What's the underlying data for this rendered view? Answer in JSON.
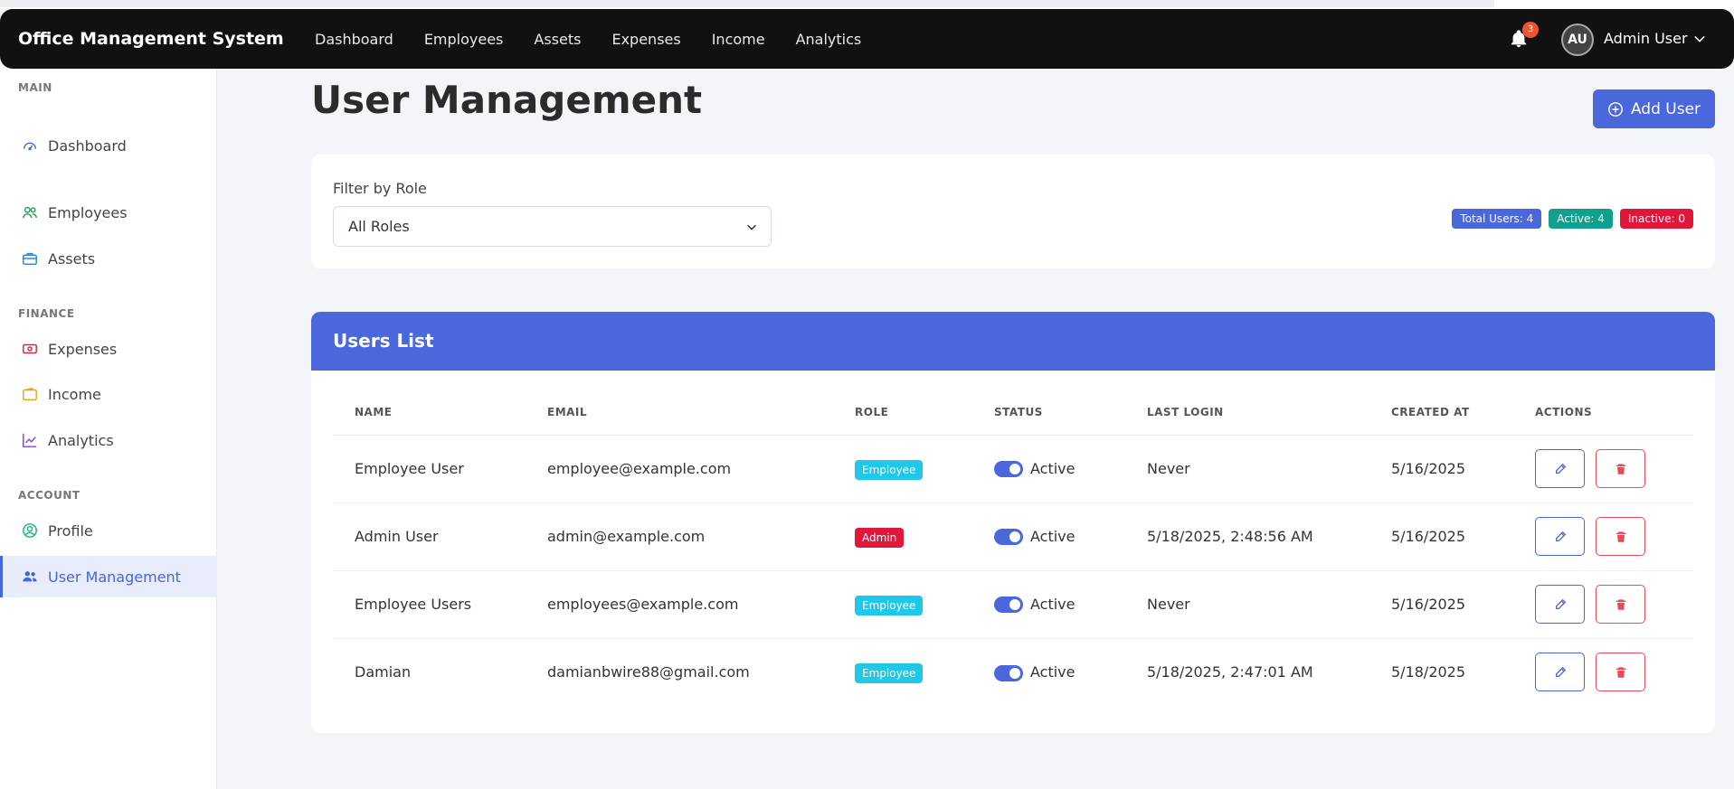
{
  "app": {
    "title": "Office Management System"
  },
  "topnav": [
    "Dashboard",
    "Employees",
    "Assets",
    "Expenses",
    "Income",
    "Analytics"
  ],
  "notifications": {
    "count": "3"
  },
  "user": {
    "initials": "AU",
    "name": "Admin User"
  },
  "sidebar": {
    "sections": {
      "main": "MAIN",
      "finance": "FINANCE",
      "account": "ACCOUNT"
    },
    "items": [
      {
        "label": "Dashboard",
        "icon": "dashboard-icon"
      },
      {
        "label": "Employees",
        "icon": "users-icon"
      },
      {
        "label": "Assets",
        "icon": "briefcase-icon"
      },
      {
        "label": "Expenses",
        "icon": "cash-icon"
      },
      {
        "label": "Income",
        "icon": "wallet-icon"
      },
      {
        "label": "Analytics",
        "icon": "chart-icon"
      },
      {
        "label": "Profile",
        "icon": "user-circle-icon"
      },
      {
        "label": "User Management",
        "icon": "people-icon"
      }
    ]
  },
  "page": {
    "title": "User Management",
    "add_button": "Add User"
  },
  "filter": {
    "label": "Filter by Role",
    "selected": "All Roles",
    "badges": {
      "total": "Total Users: 4",
      "active": "Active: 4",
      "inactive": "Inactive: 0"
    }
  },
  "users": {
    "title": "Users List",
    "columns": [
      "NAME",
      "EMAIL",
      "ROLE",
      "STATUS",
      "LAST LOGIN",
      "CREATED AT",
      "ACTIONS"
    ],
    "rows": [
      {
        "name": "Employee User",
        "email": "employee@example.com",
        "role": "Employee",
        "status": "Active",
        "last_login": "Never",
        "created_at": "5/16/2025"
      },
      {
        "name": "Admin User",
        "email": "admin@example.com",
        "role": "Admin",
        "status": "Active",
        "last_login": "5/18/2025, 2:48:56 AM",
        "created_at": "5/16/2025"
      },
      {
        "name": "Employee Users",
        "email": "employees@example.com",
        "role": "Employee",
        "status": "Active",
        "last_login": "Never",
        "created_at": "5/16/2025"
      },
      {
        "name": "Damian",
        "email": "damianbwire88@gmail.com",
        "role": "Employee",
        "status": "Active",
        "last_login": "5/18/2025, 2:47:01 AM",
        "created_at": "5/18/2025"
      }
    ]
  },
  "colors": {
    "accent": "#4a67dc",
    "employee_badge": "#1fc8e8",
    "admin_badge": "#e0163a",
    "active_badge": "#12a08c",
    "inactive_badge": "#e0163a",
    "danger": "#e94a55"
  }
}
